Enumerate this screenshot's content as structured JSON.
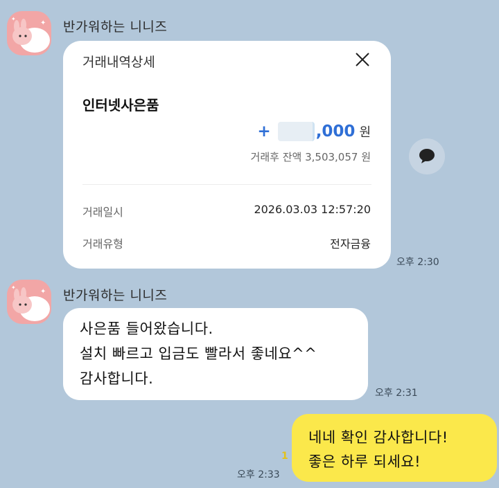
{
  "messages": [
    {
      "sender": "반가워하는 니니즈",
      "time": "오후 2:30",
      "card": {
        "title": "거래내역상세",
        "kind": "인터넷사은품",
        "amount_prefix": "+",
        "amount_visible": ",000",
        "currency": "원",
        "balance_text": "거래후 잔액 3,503,057 원",
        "rows": [
          {
            "label": "거래일시",
            "value": "2026.03.03 12:57:20"
          },
          {
            "label": "거래유형",
            "value": "전자금융"
          }
        ]
      }
    },
    {
      "sender": "반가워하는 니니즈",
      "time": "오후 2:31",
      "lines": [
        "사은품 들어왔습니다.",
        "설치 빠르고 입금도 빨라서 좋네요^^",
        "감사합니다."
      ]
    },
    {
      "time": "오후 2:33",
      "unread": "1",
      "lines": [
        "네네 확인 감사합니다!",
        "좋은 하루 되세요!"
      ]
    }
  ],
  "colors": {
    "background": "#b2c7da",
    "my_bubble": "#fbe84b",
    "their_bubble": "#ffffff",
    "amount": "#2f6fd6"
  }
}
